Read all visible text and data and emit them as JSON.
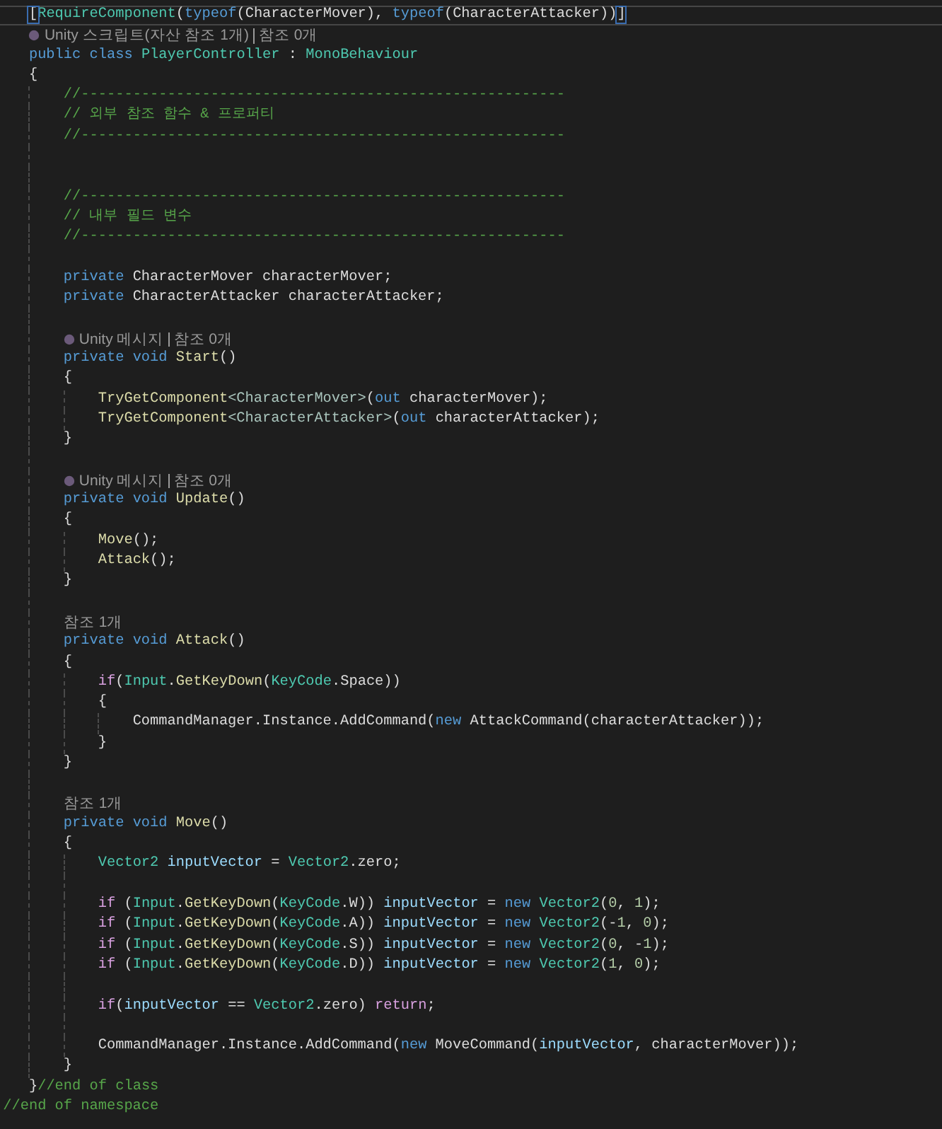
{
  "lines": [
    {
      "kind": "code",
      "current": true,
      "tokens": [
        {
          "text": "    [",
          "kind": "match"
        },
        {
          "text": "RequireComponent",
          "kind": "type"
        },
        {
          "text": "(",
          "kind": "plain"
        },
        {
          "text": "typeof",
          "kind": "keyword"
        },
        {
          "text": "(CharacterMover), ",
          "kind": "plain"
        },
        {
          "text": "typeof",
          "kind": "keyword"
        },
        {
          "text": "(CharacterAttacker))",
          "kind": "plain"
        },
        {
          "text": "]",
          "kind": "match"
        }
      ]
    },
    {
      "kind": "lens",
      "items": [
        {
          "text": "    Unity 스크립트(자산 참조 1개)",
          "unity": true
        },
        {
          "text": "참조 0개",
          "unity": false
        }
      ]
    },
    {
      "kind": "code",
      "current": false,
      "tokens": [
        {
          "text": "    public",
          "kind": "keyword"
        },
        {
          "text": " class",
          "kind": "keyword"
        },
        {
          "text": " PlayerController",
          "kind": "type"
        },
        {
          "text": " : ",
          "kind": "plain"
        },
        {
          "text": "MonoBehaviour",
          "kind": "type"
        }
      ]
    },
    {
      "kind": "code",
      "current": false,
      "tokens": [
        {
          "text": "    {",
          "kind": "plain"
        }
      ]
    },
    {
      "kind": "code",
      "current": false,
      "tokens": [
        {
          "text": "        //--------------------------------------------------------",
          "kind": "comment"
        }
      ]
    },
    {
      "kind": "code",
      "current": false,
      "tokens": [
        {
          "text": "        // 외부 참조 함수 & 프로퍼티",
          "kind": "comment"
        }
      ]
    },
    {
      "kind": "code",
      "current": false,
      "tokens": [
        {
          "text": "        //--------------------------------------------------------",
          "kind": "comment"
        }
      ]
    },
    {
      "kind": "blank"
    },
    {
      "kind": "blank"
    },
    {
      "kind": "code",
      "current": false,
      "tokens": [
        {
          "text": "        //--------------------------------------------------------",
          "kind": "comment"
        }
      ]
    },
    {
      "kind": "code",
      "current": false,
      "tokens": [
        {
          "text": "        // 내부 필드 변수",
          "kind": "comment"
        }
      ]
    },
    {
      "kind": "code",
      "current": false,
      "tokens": [
        {
          "text": "        //--------------------------------------------------------",
          "kind": "comment"
        }
      ]
    },
    {
      "kind": "blank"
    },
    {
      "kind": "code",
      "current": false,
      "tokens": [
        {
          "text": "        private",
          "kind": "keyword"
        },
        {
          "text": " CharacterMover characterMover;",
          "kind": "plain"
        }
      ]
    },
    {
      "kind": "code",
      "current": false,
      "tokens": [
        {
          "text": "        private",
          "kind": "keyword"
        },
        {
          "text": " CharacterAttacker characterAttacker;",
          "kind": "plain"
        }
      ]
    },
    {
      "kind": "blank"
    },
    {
      "kind": "lens",
      "items": [
        {
          "text": "        Unity 메시지",
          "unity": true
        },
        {
          "text": "참조 0개",
          "unity": false
        }
      ]
    },
    {
      "kind": "code",
      "current": false,
      "tokens": [
        {
          "text": "        private",
          "kind": "keyword"
        },
        {
          "text": " void",
          "kind": "keyword"
        },
        {
          "text": " Start",
          "kind": "method"
        },
        {
          "text": "()",
          "kind": "plain"
        }
      ]
    },
    {
      "kind": "code",
      "current": false,
      "tokens": [
        {
          "text": "        {",
          "kind": "plain"
        }
      ]
    },
    {
      "kind": "code",
      "current": false,
      "tokens": [
        {
          "text": "            TryGetComponent",
          "kind": "method"
        },
        {
          "text": "<CharacterMover>",
          "kind": "typearg"
        },
        {
          "text": "(",
          "kind": "plain"
        },
        {
          "text": "out",
          "kind": "keyword"
        },
        {
          "text": " characterMover);",
          "kind": "plain"
        }
      ]
    },
    {
      "kind": "code",
      "current": false,
      "tokens": [
        {
          "text": "            TryGetComponent",
          "kind": "method"
        },
        {
          "text": "<CharacterAttacker>",
          "kind": "typearg"
        },
        {
          "text": "(",
          "kind": "plain"
        },
        {
          "text": "out",
          "kind": "keyword"
        },
        {
          "text": " characterAttacker);",
          "kind": "plain"
        }
      ]
    },
    {
      "kind": "code",
      "current": false,
      "tokens": [
        {
          "text": "        }",
          "kind": "plain"
        }
      ]
    },
    {
      "kind": "blank"
    },
    {
      "kind": "lens",
      "items": [
        {
          "text": "        Unity 메시지",
          "unity": true
        },
        {
          "text": "참조 0개",
          "unity": false
        }
      ]
    },
    {
      "kind": "code",
      "current": false,
      "tokens": [
        {
          "text": "        private",
          "kind": "keyword"
        },
        {
          "text": " void",
          "kind": "keyword"
        },
        {
          "text": " Update",
          "kind": "method"
        },
        {
          "text": "()",
          "kind": "plain"
        }
      ]
    },
    {
      "kind": "code",
      "current": false,
      "tokens": [
        {
          "text": "        {",
          "kind": "plain"
        }
      ]
    },
    {
      "kind": "code",
      "current": false,
      "tokens": [
        {
          "text": "            Move",
          "kind": "method"
        },
        {
          "text": "();",
          "kind": "plain"
        }
      ]
    },
    {
      "kind": "code",
      "current": false,
      "tokens": [
        {
          "text": "            Attack",
          "kind": "method"
        },
        {
          "text": "();",
          "kind": "plain"
        }
      ]
    },
    {
      "kind": "code",
      "current": false,
      "tokens": [
        {
          "text": "        }",
          "kind": "plain"
        }
      ]
    },
    {
      "kind": "blank"
    },
    {
      "kind": "lens",
      "items": [
        {
          "text": "        참조 1개",
          "unity": false
        }
      ]
    },
    {
      "kind": "code",
      "current": false,
      "tokens": [
        {
          "text": "        private",
          "kind": "keyword"
        },
        {
          "text": " void",
          "kind": "keyword"
        },
        {
          "text": " Attack",
          "kind": "method"
        },
        {
          "text": "()",
          "kind": "plain"
        }
      ]
    },
    {
      "kind": "code",
      "current": false,
      "tokens": [
        {
          "text": "        {",
          "kind": "plain"
        }
      ]
    },
    {
      "kind": "code",
      "current": false,
      "tokens": [
        {
          "text": "            if",
          "kind": "control"
        },
        {
          "text": "(",
          "kind": "plain"
        },
        {
          "text": "Input",
          "kind": "type"
        },
        {
          "text": ".",
          "kind": "plain"
        },
        {
          "text": "GetKeyDown",
          "kind": "method"
        },
        {
          "text": "(",
          "kind": "plain"
        },
        {
          "text": "KeyCode",
          "kind": "type"
        },
        {
          "text": ".Space))",
          "kind": "plain"
        }
      ]
    },
    {
      "kind": "code",
      "current": false,
      "tokens": [
        {
          "text": "            {",
          "kind": "plain"
        }
      ]
    },
    {
      "kind": "code",
      "current": false,
      "tokens": [
        {
          "text": "                CommandManager.Instance.AddCommand(",
          "kind": "plain"
        },
        {
          "text": "new",
          "kind": "keyword"
        },
        {
          "text": " AttackCommand(characterAttacker));",
          "kind": "plain"
        }
      ]
    },
    {
      "kind": "code",
      "current": false,
      "tokens": [
        {
          "text": "            }",
          "kind": "plain"
        }
      ]
    },
    {
      "kind": "code",
      "current": false,
      "tokens": [
        {
          "text": "        }",
          "kind": "plain"
        }
      ]
    },
    {
      "kind": "blank"
    },
    {
      "kind": "lens",
      "items": [
        {
          "text": "        참조 1개",
          "unity": false
        }
      ]
    },
    {
      "kind": "code",
      "current": false,
      "tokens": [
        {
          "text": "        private",
          "kind": "keyword"
        },
        {
          "text": " void",
          "kind": "keyword"
        },
        {
          "text": " Move",
          "kind": "method"
        },
        {
          "text": "()",
          "kind": "plain"
        }
      ]
    },
    {
      "kind": "code",
      "current": false,
      "tokens": [
        {
          "text": "        {",
          "kind": "plain"
        }
      ]
    },
    {
      "kind": "code",
      "current": false,
      "tokens": [
        {
          "text": "            Vector2",
          "kind": "type"
        },
        {
          "text": " inputVector",
          "kind": "variable"
        },
        {
          "text": " = ",
          "kind": "plain"
        },
        {
          "text": "Vector2",
          "kind": "type"
        },
        {
          "text": ".zero;",
          "kind": "plain"
        }
      ]
    },
    {
      "kind": "blank"
    },
    {
      "kind": "code",
      "current": false,
      "tokens": [
        {
          "text": "            if",
          "kind": "control"
        },
        {
          "text": " (",
          "kind": "plain"
        },
        {
          "text": "Input",
          "kind": "type"
        },
        {
          "text": ".",
          "kind": "plain"
        },
        {
          "text": "GetKeyDown",
          "kind": "method"
        },
        {
          "text": "(",
          "kind": "plain"
        },
        {
          "text": "KeyCode",
          "kind": "type"
        },
        {
          "text": ".W)) ",
          "kind": "plain"
        },
        {
          "text": "inputVector",
          "kind": "variable"
        },
        {
          "text": " = ",
          "kind": "plain"
        },
        {
          "text": "new",
          "kind": "keyword"
        },
        {
          "text": " Vector2",
          "kind": "type"
        },
        {
          "text": "(",
          "kind": "plain"
        },
        {
          "text": "0",
          "kind": "number"
        },
        {
          "text": ", ",
          "kind": "plain"
        },
        {
          "text": "1",
          "kind": "number"
        },
        {
          "text": ");",
          "kind": "plain"
        }
      ]
    },
    {
      "kind": "code",
      "current": false,
      "tokens": [
        {
          "text": "            if",
          "kind": "control"
        },
        {
          "text": " (",
          "kind": "plain"
        },
        {
          "text": "Input",
          "kind": "type"
        },
        {
          "text": ".",
          "kind": "plain"
        },
        {
          "text": "GetKeyDown",
          "kind": "method"
        },
        {
          "text": "(",
          "kind": "plain"
        },
        {
          "text": "KeyCode",
          "kind": "type"
        },
        {
          "text": ".A)) ",
          "kind": "plain"
        },
        {
          "text": "inputVector",
          "kind": "variable"
        },
        {
          "text": " = ",
          "kind": "plain"
        },
        {
          "text": "new",
          "kind": "keyword"
        },
        {
          "text": " Vector2",
          "kind": "type"
        },
        {
          "text": "(-",
          "kind": "plain"
        },
        {
          "text": "1",
          "kind": "number"
        },
        {
          "text": ", ",
          "kind": "plain"
        },
        {
          "text": "0",
          "kind": "number"
        },
        {
          "text": ");",
          "kind": "plain"
        }
      ]
    },
    {
      "kind": "code",
      "current": false,
      "tokens": [
        {
          "text": "            if",
          "kind": "control"
        },
        {
          "text": " (",
          "kind": "plain"
        },
        {
          "text": "Input",
          "kind": "type"
        },
        {
          "text": ".",
          "kind": "plain"
        },
        {
          "text": "GetKeyDown",
          "kind": "method"
        },
        {
          "text": "(",
          "kind": "plain"
        },
        {
          "text": "KeyCode",
          "kind": "type"
        },
        {
          "text": ".S)) ",
          "kind": "plain"
        },
        {
          "text": "inputVector",
          "kind": "variable"
        },
        {
          "text": " = ",
          "kind": "plain"
        },
        {
          "text": "new",
          "kind": "keyword"
        },
        {
          "text": " Vector2",
          "kind": "type"
        },
        {
          "text": "(",
          "kind": "plain"
        },
        {
          "text": "0",
          "kind": "number"
        },
        {
          "text": ", -",
          "kind": "plain"
        },
        {
          "text": "1",
          "kind": "number"
        },
        {
          "text": ");",
          "kind": "plain"
        }
      ]
    },
    {
      "kind": "code",
      "current": false,
      "tokens": [
        {
          "text": "            if",
          "kind": "control"
        },
        {
          "text": " (",
          "kind": "plain"
        },
        {
          "text": "Input",
          "kind": "type"
        },
        {
          "text": ".",
          "kind": "plain"
        },
        {
          "text": "GetKeyDown",
          "kind": "method"
        },
        {
          "text": "(",
          "kind": "plain"
        },
        {
          "text": "KeyCode",
          "kind": "type"
        },
        {
          "text": ".D)) ",
          "kind": "plain"
        },
        {
          "text": "inputVector",
          "kind": "variable"
        },
        {
          "text": " = ",
          "kind": "plain"
        },
        {
          "text": "new",
          "kind": "keyword"
        },
        {
          "text": " Vector2",
          "kind": "type"
        },
        {
          "text": "(",
          "kind": "plain"
        },
        {
          "text": "1",
          "kind": "number"
        },
        {
          "text": ", ",
          "kind": "plain"
        },
        {
          "text": "0",
          "kind": "number"
        },
        {
          "text": ");",
          "kind": "plain"
        }
      ]
    },
    {
      "kind": "blank"
    },
    {
      "kind": "code",
      "current": false,
      "tokens": [
        {
          "text": "            if",
          "kind": "control"
        },
        {
          "text": "(",
          "kind": "plain"
        },
        {
          "text": "inputVector",
          "kind": "variable"
        },
        {
          "text": " == ",
          "kind": "plain"
        },
        {
          "text": "Vector2",
          "kind": "type"
        },
        {
          "text": ".zero) ",
          "kind": "plain"
        },
        {
          "text": "return",
          "kind": "control"
        },
        {
          "text": ";",
          "kind": "plain"
        }
      ]
    },
    {
      "kind": "blank"
    },
    {
      "kind": "code",
      "current": false,
      "tokens": [
        {
          "text": "            CommandManager.Instance.AddCommand(",
          "kind": "plain"
        },
        {
          "text": "new",
          "kind": "keyword"
        },
        {
          "text": " MoveCommand(",
          "kind": "plain"
        },
        {
          "text": "inputVector",
          "kind": "variable"
        },
        {
          "text": ", characterMover));",
          "kind": "plain"
        }
      ]
    },
    {
      "kind": "code",
      "current": false,
      "tokens": [
        {
          "text": "        }",
          "kind": "plain"
        }
      ]
    },
    {
      "kind": "code",
      "current": false,
      "tokens": [
        {
          "text": "    }",
          "kind": "plain"
        },
        {
          "text": "//end of class",
          "kind": "comment"
        }
      ]
    },
    {
      "kind": "code",
      "current": false,
      "tokens": [
        {
          "text": " //end of namespace",
          "kind": "comment"
        }
      ]
    }
  ]
}
